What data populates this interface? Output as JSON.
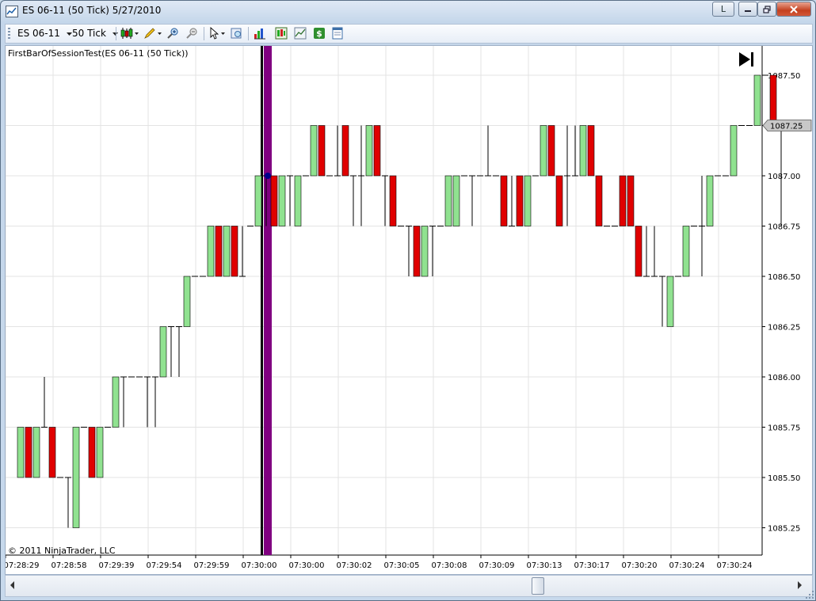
{
  "window": {
    "title": "ES 06-11 (50 Tick)  5/27/2010",
    "minimize_label": "L",
    "colors": {
      "bull": "#90e290",
      "bear": "#e00000",
      "session_line": "#000000",
      "session_bar": "#800080",
      "marker": "#00008b"
    }
  },
  "toolbar": {
    "instrument": "ES 06-11",
    "period": "50 Tick",
    "icons": [
      "chart-style-icon",
      "draw-pencil-icon",
      "zoom-in-icon",
      "zoom-out-icon",
      "pointer-select-icon",
      "properties-icon",
      "bar-chart-icon",
      "data-box-icon",
      "chart-trader-icon",
      "dollar-icon",
      "templates-icon"
    ]
  },
  "chart": {
    "indicator_label": "FirstBarOfSessionTest(ES 06-11 (50 Tick))",
    "copyright": "© 2011 NinjaTrader, LLC",
    "last_price_label": "1087.25"
  },
  "chart_data": {
    "type": "candlestick",
    "instrument": "ES 06-11",
    "interval": "50 Tick",
    "date": "5/27/2010",
    "y_tick_labels": [
      "1087.50",
      "1087.25",
      "1087.00",
      "1086.75",
      "1086.50",
      "1086.25",
      "1086.00",
      "1085.75",
      "1085.50",
      "1085.25"
    ],
    "ylim": [
      1085.2,
      1087.6
    ],
    "x_tick_labels": [
      "07:28:29",
      "07:28:58",
      "07:29:39",
      "07:29:54",
      "07:29:59",
      "07:30:00",
      "07:30:00",
      "07:30:02",
      "07:30:05",
      "07:30:08",
      "07:30:09",
      "07:30:13",
      "07:30:17",
      "07:30:20",
      "07:30:24",
      "07:30:24"
    ],
    "grid": true,
    "session_start_bar_index": 31,
    "last_price": 1087.25,
    "bars": [
      {
        "o": 1085.5,
        "h": 1085.75,
        "l": 1085.5,
        "c": 1085.75
      },
      {
        "o": 1085.75,
        "h": 1085.75,
        "l": 1085.5,
        "c": 1085.5
      },
      {
        "o": 1085.5,
        "h": 1085.75,
        "l": 1085.5,
        "c": 1085.75
      },
      {
        "o": 1085.75,
        "h": 1086.0,
        "l": 1085.75,
        "c": 1085.75
      },
      {
        "o": 1085.75,
        "h": 1085.75,
        "l": 1085.5,
        "c": 1085.5
      },
      {
        "o": 1085.5,
        "h": 1085.5,
        "l": 1085.5,
        "c": 1085.5
      },
      {
        "o": 1085.5,
        "h": 1085.5,
        "l": 1085.25,
        "c": 1085.5
      },
      {
        "o": 1085.25,
        "h": 1085.75,
        "l": 1085.25,
        "c": 1085.75
      },
      {
        "o": 1085.75,
        "h": 1085.75,
        "l": 1085.75,
        "c": 1085.75
      },
      {
        "o": 1085.75,
        "h": 1085.75,
        "l": 1085.5,
        "c": 1085.5
      },
      {
        "o": 1085.5,
        "h": 1085.75,
        "l": 1085.5,
        "c": 1085.75
      },
      {
        "o": 1085.75,
        "h": 1085.75,
        "l": 1085.75,
        "c": 1085.75
      },
      {
        "o": 1085.75,
        "h": 1086.0,
        "l": 1085.75,
        "c": 1086.0
      },
      {
        "o": 1086.0,
        "h": 1086.0,
        "l": 1085.75,
        "c": 1086.0
      },
      {
        "o": 1086.0,
        "h": 1086.0,
        "l": 1086.0,
        "c": 1086.0
      },
      {
        "o": 1086.0,
        "h": 1086.0,
        "l": 1086.0,
        "c": 1086.0
      },
      {
        "o": 1086.0,
        "h": 1086.0,
        "l": 1085.75,
        "c": 1086.0
      },
      {
        "o": 1086.0,
        "h": 1086.0,
        "l": 1085.75,
        "c": 1086.0
      },
      {
        "o": 1086.0,
        "h": 1086.25,
        "l": 1086.0,
        "c": 1086.25
      },
      {
        "o": 1086.25,
        "h": 1086.25,
        "l": 1086.0,
        "c": 1086.25
      },
      {
        "o": 1086.25,
        "h": 1086.25,
        "l": 1086.0,
        "c": 1086.25
      },
      {
        "o": 1086.25,
        "h": 1086.5,
        "l": 1086.25,
        "c": 1086.5
      },
      {
        "o": 1086.5,
        "h": 1086.5,
        "l": 1086.5,
        "c": 1086.5
      },
      {
        "o": 1086.5,
        "h": 1086.5,
        "l": 1086.5,
        "c": 1086.5
      },
      {
        "o": 1086.5,
        "h": 1086.75,
        "l": 1086.5,
        "c": 1086.75
      },
      {
        "o": 1086.75,
        "h": 1086.75,
        "l": 1086.5,
        "c": 1086.5
      },
      {
        "o": 1086.5,
        "h": 1086.75,
        "l": 1086.5,
        "c": 1086.75
      },
      {
        "o": 1086.75,
        "h": 1086.75,
        "l": 1086.5,
        "c": 1086.5
      },
      {
        "o": 1086.5,
        "h": 1086.75,
        "l": 1086.5,
        "c": 1086.5
      },
      {
        "o": 1086.75,
        "h": 1086.75,
        "l": 1086.75,
        "c": 1086.75
      },
      {
        "o": 1086.75,
        "h": 1087.0,
        "l": 1086.75,
        "c": 1087.0
      },
      {
        "o": 1087.0,
        "h": 1087.0,
        "l": 1086.75,
        "c": 1087.0
      },
      {
        "o": 1087.0,
        "h": 1087.0,
        "l": 1086.75,
        "c": 1086.75
      },
      {
        "o": 1086.75,
        "h": 1087.0,
        "l": 1086.75,
        "c": 1087.0
      },
      {
        "o": 1087.0,
        "h": 1087.0,
        "l": 1086.75,
        "c": 1087.0
      },
      {
        "o": 1086.75,
        "h": 1087.0,
        "l": 1086.75,
        "c": 1087.0
      },
      {
        "o": 1087.0,
        "h": 1087.0,
        "l": 1087.0,
        "c": 1087.0
      },
      {
        "o": 1087.0,
        "h": 1087.25,
        "l": 1087.0,
        "c": 1087.25
      },
      {
        "o": 1087.25,
        "h": 1087.25,
        "l": 1087.0,
        "c": 1087.0
      },
      {
        "o": 1087.0,
        "h": 1087.0,
        "l": 1087.0,
        "c": 1087.0
      },
      {
        "o": 1087.0,
        "h": 1087.25,
        "l": 1087.0,
        "c": 1087.0
      },
      {
        "o": 1087.25,
        "h": 1087.25,
        "l": 1087.0,
        "c": 1087.0
      },
      {
        "o": 1087.0,
        "h": 1087.0,
        "l": 1086.75,
        "c": 1087.0
      },
      {
        "o": 1087.0,
        "h": 1087.25,
        "l": 1086.75,
        "c": 1087.0
      },
      {
        "o": 1087.0,
        "h": 1087.25,
        "l": 1087.0,
        "c": 1087.25
      },
      {
        "o": 1087.25,
        "h": 1087.25,
        "l": 1087.0,
        "c": 1087.0
      },
      {
        "o": 1087.0,
        "h": 1087.0,
        "l": 1086.75,
        "c": 1087.0
      },
      {
        "o": 1087.0,
        "h": 1087.0,
        "l": 1086.75,
        "c": 1086.75
      },
      {
        "o": 1086.75,
        "h": 1086.75,
        "l": 1086.75,
        "c": 1086.75
      },
      {
        "o": 1086.75,
        "h": 1086.75,
        "l": 1086.5,
        "c": 1086.75
      },
      {
        "o": 1086.75,
        "h": 1086.75,
        "l": 1086.5,
        "c": 1086.5
      },
      {
        "o": 1086.5,
        "h": 1086.75,
        "l": 1086.5,
        "c": 1086.75
      },
      {
        "o": 1086.75,
        "h": 1086.75,
        "l": 1086.5,
        "c": 1086.75
      },
      {
        "o": 1086.75,
        "h": 1086.75,
        "l": 1086.75,
        "c": 1086.75
      },
      {
        "o": 1086.75,
        "h": 1087.0,
        "l": 1086.75,
        "c": 1087.0
      },
      {
        "o": 1086.75,
        "h": 1087.0,
        "l": 1086.75,
        "c": 1087.0
      },
      {
        "o": 1087.0,
        "h": 1087.0,
        "l": 1087.0,
        "c": 1087.0
      },
      {
        "o": 1087.0,
        "h": 1087.0,
        "l": 1086.75,
        "c": 1087.0
      },
      {
        "o": 1087.0,
        "h": 1087.0,
        "l": 1087.0,
        "c": 1087.0
      },
      {
        "o": 1087.0,
        "h": 1087.25,
        "l": 1087.0,
        "c": 1087.0
      },
      {
        "o": 1087.0,
        "h": 1087.0,
        "l": 1087.0,
        "c": 1087.0
      },
      {
        "o": 1087.0,
        "h": 1087.0,
        "l": 1086.75,
        "c": 1086.75
      },
      {
        "o": 1086.75,
        "h": 1087.0,
        "l": 1086.75,
        "c": 1086.75
      },
      {
        "o": 1087.0,
        "h": 1087.0,
        "l": 1086.75,
        "c": 1086.75
      },
      {
        "o": 1086.75,
        "h": 1087.0,
        "l": 1086.75,
        "c": 1087.0
      },
      {
        "o": 1087.0,
        "h": 1087.0,
        "l": 1087.0,
        "c": 1087.0
      },
      {
        "o": 1087.0,
        "h": 1087.25,
        "l": 1087.0,
        "c": 1087.25
      },
      {
        "o": 1087.25,
        "h": 1087.25,
        "l": 1087.0,
        "c": 1087.0
      },
      {
        "o": 1087.0,
        "h": 1087.0,
        "l": 1086.75,
        "c": 1086.75
      },
      {
        "o": 1087.0,
        "h": 1087.25,
        "l": 1086.75,
        "c": 1087.0
      },
      {
        "o": 1087.0,
        "h": 1087.25,
        "l": 1087.0,
        "c": 1087.0
      },
      {
        "o": 1087.0,
        "h": 1087.25,
        "l": 1087.0,
        "c": 1087.25
      },
      {
        "o": 1087.25,
        "h": 1087.25,
        "l": 1087.0,
        "c": 1087.0
      },
      {
        "o": 1087.0,
        "h": 1087.0,
        "l": 1086.75,
        "c": 1086.75
      },
      {
        "o": 1086.75,
        "h": 1086.75,
        "l": 1086.75,
        "c": 1086.75
      },
      {
        "o": 1086.75,
        "h": 1086.75,
        "l": 1086.75,
        "c": 1086.75
      },
      {
        "o": 1087.0,
        "h": 1087.0,
        "l": 1086.75,
        "c": 1086.75
      },
      {
        "o": 1087.0,
        "h": 1087.0,
        "l": 1086.75,
        "c": 1086.75
      },
      {
        "o": 1086.75,
        "h": 1086.75,
        "l": 1086.5,
        "c": 1086.5
      },
      {
        "o": 1086.5,
        "h": 1086.75,
        "l": 1086.5,
        "c": 1086.5
      },
      {
        "o": 1086.5,
        "h": 1086.75,
        "l": 1086.5,
        "c": 1086.5
      },
      {
        "o": 1086.5,
        "h": 1086.5,
        "l": 1086.25,
        "c": 1086.5
      },
      {
        "o": 1086.25,
        "h": 1086.5,
        "l": 1086.25,
        "c": 1086.5
      },
      {
        "o": 1086.5,
        "h": 1086.5,
        "l": 1086.5,
        "c": 1086.5
      },
      {
        "o": 1086.5,
        "h": 1086.75,
        "l": 1086.5,
        "c": 1086.75
      },
      {
        "o": 1086.75,
        "h": 1086.75,
        "l": 1086.75,
        "c": 1086.75
      },
      {
        "o": 1086.75,
        "h": 1087.0,
        "l": 1086.5,
        "c": 1086.75
      },
      {
        "o": 1086.75,
        "h": 1087.0,
        "l": 1086.75,
        "c": 1087.0
      },
      {
        "o": 1087.0,
        "h": 1087.0,
        "l": 1087.0,
        "c": 1087.0
      },
      {
        "o": 1087.0,
        "h": 1087.0,
        "l": 1087.0,
        "c": 1087.0
      },
      {
        "o": 1087.0,
        "h": 1087.25,
        "l": 1087.0,
        "c": 1087.25
      },
      {
        "o": 1087.25,
        "h": 1087.25,
        "l": 1087.25,
        "c": 1087.25
      },
      {
        "o": 1087.25,
        "h": 1087.25,
        "l": 1087.25,
        "c": 1087.25
      },
      {
        "o": 1087.25,
        "h": 1087.5,
        "l": 1087.25,
        "c": 1087.5
      },
      {
        "o": 1087.5,
        "h": 1087.5,
        "l": 1087.5,
        "c": 1087.5
      },
      {
        "o": 1087.5,
        "h": 1087.5,
        "l": 1087.25,
        "c": 1087.25
      },
      {
        "o": 1087.25,
        "h": 1087.25,
        "l": 1086.75,
        "c": 1087.25
      }
    ]
  }
}
